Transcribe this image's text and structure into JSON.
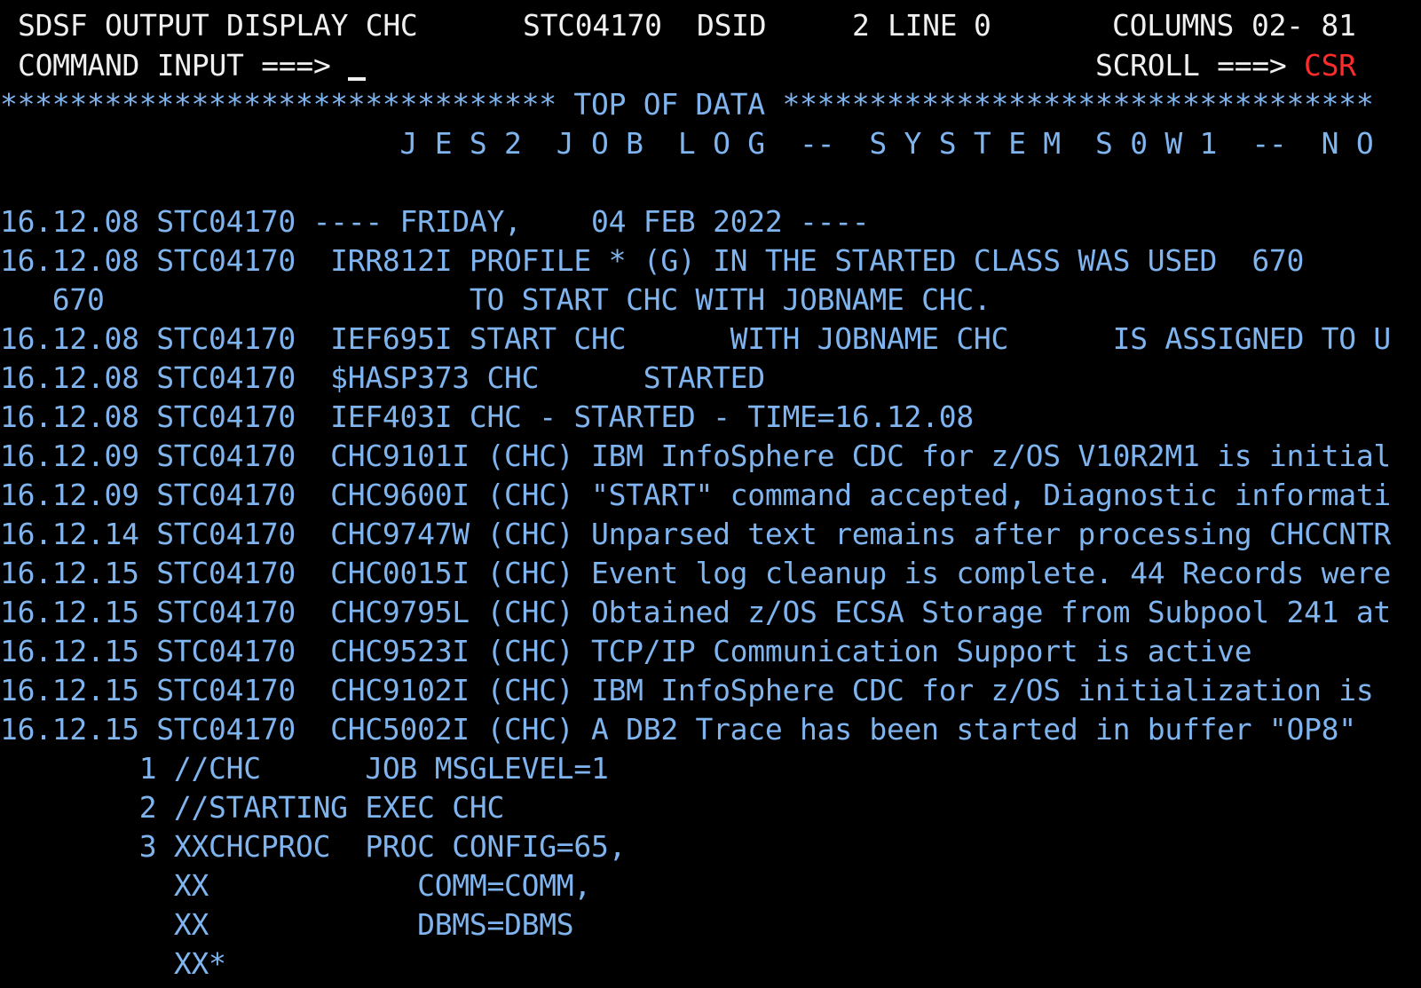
{
  "header": {
    "title": "SDSF OUTPUT DISPLAY CHC",
    "job_id": "STC04170",
    "dsid_label": "DSID",
    "dsid_value": "2",
    "line_label": "LINE",
    "line_value": "0",
    "columns_label": "COLUMNS",
    "columns_value": "02- 81"
  },
  "command": {
    "label": "COMMAND INPUT ===>",
    "value": "",
    "scroll_label": "SCROLL ===>",
    "scroll_value": "CSR"
  },
  "banner": {
    "top_of_data": "******************************** TOP OF DATA **********************************",
    "job_log_title": "                       J E S 2  J O B  L O G  --  S Y S T E M  S 0 W 1  --  N O"
  },
  "log_lines": [
    "16.12.08 STC04170 ---- FRIDAY,    04 FEB 2022 ----",
    "16.12.08 STC04170  IRR812I PROFILE * (G) IN THE STARTED CLASS WAS USED  670",
    "   670                     TO START CHC WITH JOBNAME CHC.",
    "16.12.08 STC04170  IEF695I START CHC      WITH JOBNAME CHC      IS ASSIGNED TO U",
    "16.12.08 STC04170  $HASP373 CHC      STARTED",
    "16.12.08 STC04170  IEF403I CHC - STARTED - TIME=16.12.08",
    "16.12.09 STC04170  CHC9101I (CHC) IBM InfoSphere CDC for z/OS V10R2M1 is initial",
    "16.12.09 STC04170  CHC9600I (CHC) \"START\" command accepted, Diagnostic informati",
    "16.12.14 STC04170  CHC9747W (CHC) Unparsed text remains after processing CHCCNTR",
    "16.12.15 STC04170  CHC0015I (CHC) Event log cleanup is complete. 44 Records were",
    "16.12.15 STC04170  CHC9795L (CHC) Obtained z/OS ECSA Storage from Subpool 241 at",
    "16.12.15 STC04170  CHC9523I (CHC) TCP/IP Communication Support is active",
    "16.12.15 STC04170  CHC9102I (CHC) IBM InfoSphere CDC for z/OS initialization is",
    "16.12.15 STC04170  CHC5002I (CHC) A DB2 Trace has been started in buffer \"OP8\""
  ],
  "jcl_lines": [
    "        1 //CHC      JOB MSGLEVEL=1",
    "        2 //STARTING EXEC CHC",
    "        3 XXCHCPROC  PROC CONFIG=65,",
    "          XX            COMM=COMM,",
    "          XX            DBMS=DBMS",
    "          XX*"
  ],
  "colors": {
    "background": "#000000",
    "protected_text": "#f0f0f0",
    "data_text": "#7fb4ef",
    "highlight": "#ff2b2b"
  }
}
